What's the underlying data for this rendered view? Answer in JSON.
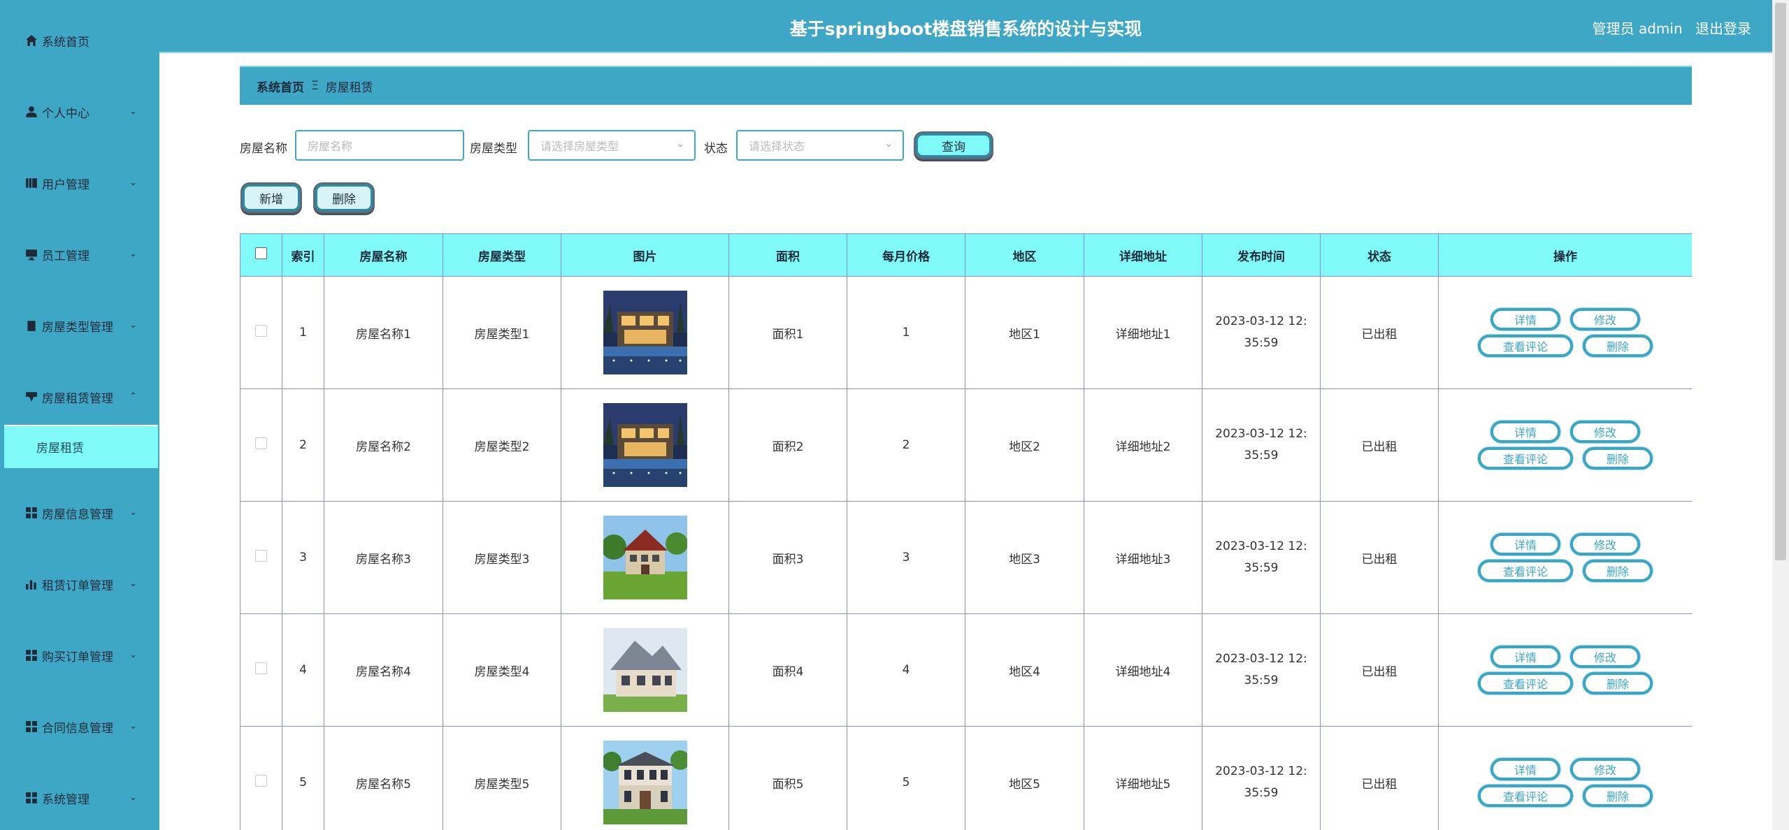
{
  "header": {
    "title": "基于springboot楼盘销售系统的设计与实现",
    "user_label": "管理员 admin",
    "logout": "退出登录"
  },
  "sidebar": {
    "items": [
      {
        "label": "系统首页",
        "icon": "home-icon"
      },
      {
        "label": "个人中心",
        "icon": "person-icon"
      },
      {
        "label": "用户管理",
        "icon": "book-icon"
      },
      {
        "label": "员工管理",
        "icon": "monitor-icon"
      },
      {
        "label": "房屋类型管理",
        "icon": "clipboard-check-icon"
      },
      {
        "label": "房屋租赁管理",
        "icon": "message-icon"
      },
      {
        "label": "房屋信息管理",
        "icon": "grid-icon"
      },
      {
        "label": "租赁订单管理",
        "icon": "bar-chart-icon"
      },
      {
        "label": "购买订单管理",
        "icon": "grid-icon"
      },
      {
        "label": "合同信息管理",
        "icon": "grid-icon"
      },
      {
        "label": "系统管理",
        "icon": "grid-icon"
      }
    ],
    "active_sub": "房屋租赁"
  },
  "breadcrumb": {
    "home": "系统首页",
    "separator": "Ξ",
    "current": "房屋租赁"
  },
  "search": {
    "name_label": "房屋名称",
    "name_placeholder": "房屋名称",
    "type_label": "房屋类型",
    "type_placeholder": "请选择房屋类型",
    "status_label": "状态",
    "status_placeholder": "请选择状态",
    "query_button": "查询"
  },
  "toolbar": {
    "add_button": "新增",
    "delete_button": "删除"
  },
  "table": {
    "headers": [
      "索引",
      "房屋名称",
      "房屋类型",
      "图片",
      "面积",
      "每月价格",
      "地区",
      "详细地址",
      "发布时间",
      "状态",
      "操作"
    ],
    "rows": [
      {
        "index": "1",
        "name": "房屋名称1",
        "type": "房屋类型1",
        "image": "modern-villa-night",
        "area": "面积1",
        "price": "1",
        "region": "地区1",
        "address": "详细地址1",
        "time": "2023-03-12 12:35:59",
        "status": "已出租"
      },
      {
        "index": "2",
        "name": "房屋名称2",
        "type": "房屋类型2",
        "image": "modern-villa-night",
        "area": "面积2",
        "price": "2",
        "region": "地区2",
        "address": "详细地址2",
        "time": "2023-03-12 12:35:59",
        "status": "已出租"
      },
      {
        "index": "3",
        "name": "房屋名称3",
        "type": "房屋类型3",
        "image": "country-house-lawn",
        "area": "面积3",
        "price": "3",
        "region": "地区3",
        "address": "详细地址3",
        "time": "2023-03-12 12:35:59",
        "status": "已出租"
      },
      {
        "index": "4",
        "name": "房屋名称4",
        "type": "房屋类型4",
        "image": "grey-roof-villa",
        "area": "面积4",
        "price": "4",
        "region": "地区4",
        "address": "详细地址4",
        "time": "2023-03-12 12:35:59",
        "status": "已出租"
      },
      {
        "index": "5",
        "name": "房屋名称5",
        "type": "房屋类型5",
        "image": "two-storey-villa",
        "area": "面积5",
        "price": "5",
        "region": "地区5",
        "address": "详细地址5",
        "time": "2023-03-12 12:35:59",
        "status": "已出租"
      }
    ],
    "actions": {
      "detail": "详情",
      "edit": "修改",
      "comments": "查看评论",
      "delete": "删除"
    }
  },
  "colors": {
    "primary": "#3fa7c6",
    "accent": "#7ffaf9",
    "border": "#8b8fc8"
  }
}
